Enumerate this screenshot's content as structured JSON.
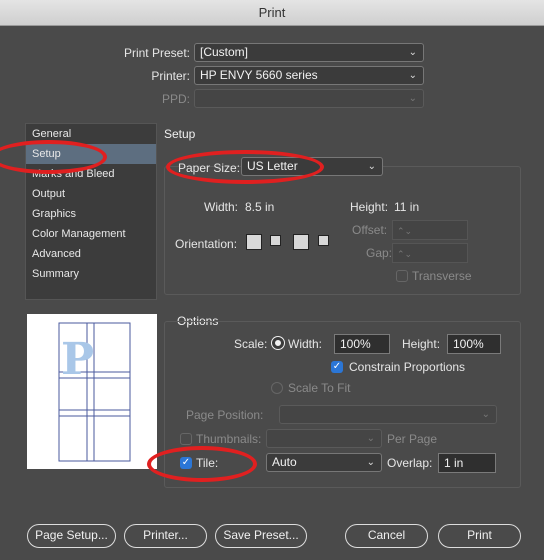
{
  "window": {
    "title": "Print"
  },
  "top": {
    "preset_label": "Print Preset:",
    "preset_value": "[Custom]",
    "printer_label": "Printer:",
    "printer_value": "HP ENVY 5660 series",
    "ppd_label": "PPD:",
    "ppd_value": ""
  },
  "sidebar": {
    "items": [
      {
        "label": "General"
      },
      {
        "label": "Setup"
      },
      {
        "label": "Marks and Bleed"
      },
      {
        "label": "Output"
      },
      {
        "label": "Graphics"
      },
      {
        "label": "Color Management"
      },
      {
        "label": "Advanced"
      },
      {
        "label": "Summary"
      }
    ],
    "selected_index": 1
  },
  "setup": {
    "heading": "Setup",
    "paper_size_label": "Paper Size:",
    "paper_size_value": "US Letter",
    "width_label": "Width:",
    "width_value": "8.5 in",
    "height_label": "Height:",
    "height_value": "11 in",
    "orientation_label": "Orientation:",
    "offset_label": "Offset:",
    "gap_label": "Gap:",
    "transverse_label": "Transverse"
  },
  "options": {
    "heading": "Options",
    "scale_label": "Scale:",
    "width_label": "Width:",
    "width_value": "100%",
    "height_label": "Height:",
    "height_value": "100%",
    "constrain_label": "Constrain Proportions",
    "constrain_checked": true,
    "scale_to_fit_label": "Scale To Fit",
    "page_position_label": "Page Position:",
    "page_position_value": "",
    "thumbnails_label": "Thumbnails:",
    "per_page_label": "Per Page",
    "tile_label": "Tile:",
    "tile_checked": true,
    "tile_value": "Auto",
    "overlap_label": "Overlap:",
    "overlap_value": "1 in"
  },
  "preview": {
    "letter": "P"
  },
  "buttons": {
    "page_setup": "Page Setup...",
    "printer": "Printer...",
    "save_preset": "Save Preset...",
    "cancel": "Cancel",
    "print": "Print"
  },
  "colors": {
    "annotation": "#e02020",
    "accent": "#2b76d6",
    "dialog_bg": "#4a4a4a",
    "sidebar_selected": "#5d6e80"
  }
}
